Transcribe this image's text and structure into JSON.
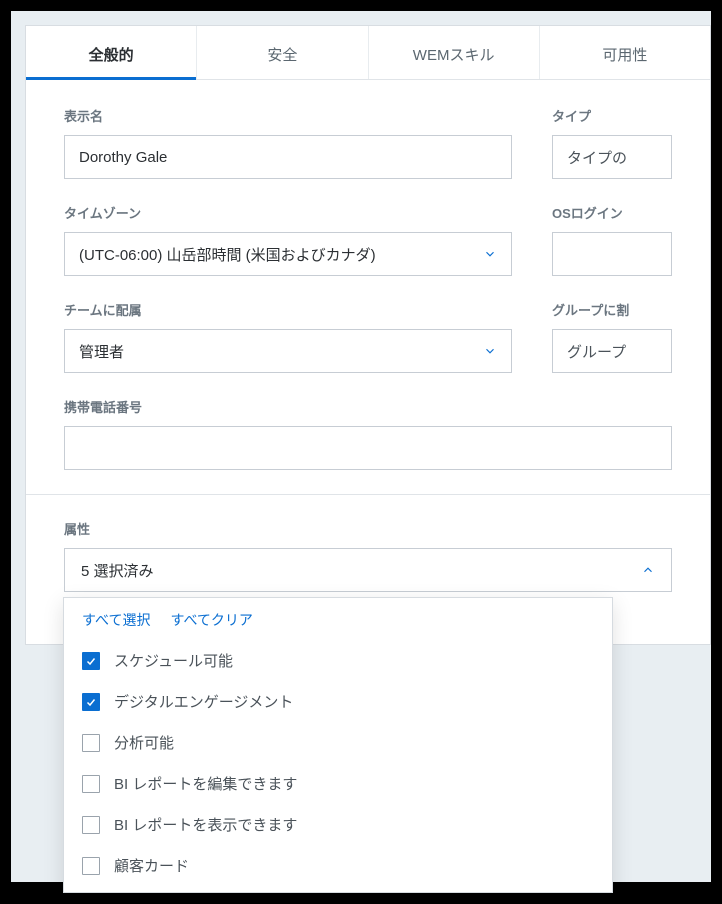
{
  "tabs": {
    "general": "全般的",
    "security": "安全",
    "wem": "WEMスキル",
    "availability": "可用性"
  },
  "labels": {
    "displayName": "表示名",
    "type": "タイプ",
    "timezone": "タイムゾーン",
    "osLogin": "OSログイン",
    "team": "チームに配属",
    "group": "グループに割",
    "mobile": "携帯電話番号",
    "attributes": "属性"
  },
  "values": {
    "displayName": "Dorothy Gale",
    "typePlaceholder": "タイプの",
    "timezone": "(UTC-06:00) 山岳部時間 (米国およびカナダ)",
    "team": "管理者",
    "groupPlaceholder": "グループ",
    "attrSummary": "5 選択済み"
  },
  "dropdown": {
    "selectAll": "すべて選択",
    "clearAll": "すべてクリア",
    "items": [
      {
        "label": "スケジュール可能",
        "checked": true
      },
      {
        "label": "デジタルエンゲージメント",
        "checked": true
      },
      {
        "label": "分析可能",
        "checked": false
      },
      {
        "label": "BI レポートを編集できます",
        "checked": false
      },
      {
        "label": "BI レポートを表示できます",
        "checked": false
      },
      {
        "label": "顧客カード",
        "checked": false
      }
    ]
  }
}
